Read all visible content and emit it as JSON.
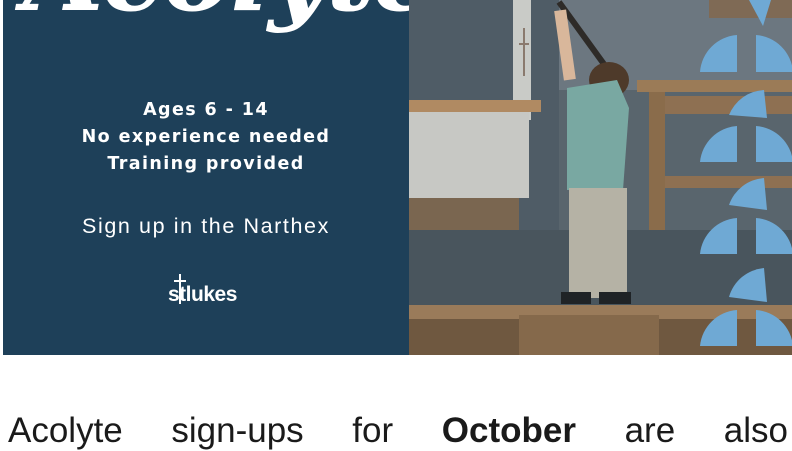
{
  "banner": {
    "script_title": "Acolytes",
    "info_lines": [
      "Ages 6 - 14",
      "No experience needed",
      "Training provided"
    ],
    "signup_text": "Sign up in the Narthex",
    "logo_text": "stlukes"
  },
  "body_paragraph": {
    "words": [
      "Acolyte",
      "sign-ups",
      "for",
      "October",
      "are",
      "also"
    ],
    "bold_word": "October"
  },
  "colors": {
    "panel_bg": "#1e4059",
    "accent_shape": "#6fa9d4",
    "text_dark": "#1a1a1a"
  }
}
